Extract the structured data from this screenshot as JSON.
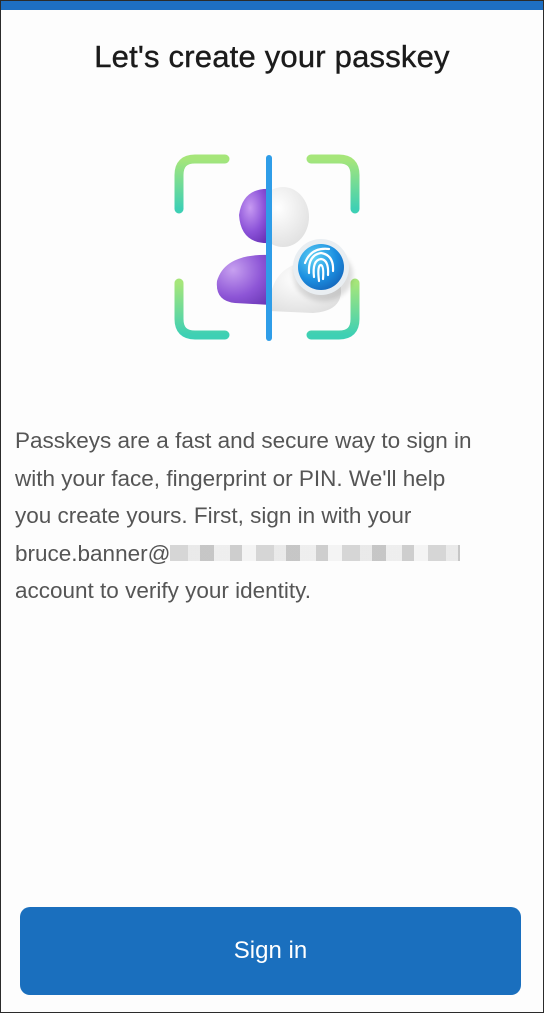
{
  "header": {
    "title": "Let's create your passkey",
    "accent_color": "#1e6fc3"
  },
  "illustration": {
    "icon": "passkey-face-fingerprint-icon",
    "colors": [
      "#3dd6b0",
      "#8a4fd6",
      "#1e8fe0"
    ]
  },
  "body": {
    "line1": "Passkeys are a fast and secure way to sign in",
    "line2": "with your face, fingerprint or PIN. We'll help",
    "line3": "you create yours. First, sign in with your",
    "email_prefix": "bruce.banner@",
    "line5": "account to verify your identity."
  },
  "actions": {
    "signin_label": "Sign in",
    "button_color": "#1a6fbe"
  }
}
